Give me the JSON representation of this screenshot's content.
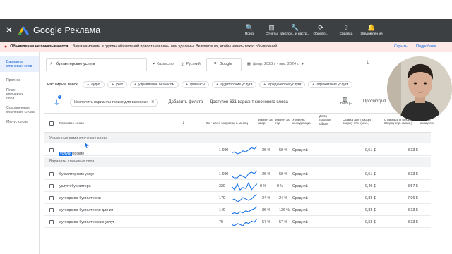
{
  "app": {
    "title": "Google Реклама"
  },
  "toolbar": [
    {
      "label": "Поиск",
      "icon": "search-icon",
      "glyph": "🔍"
    },
    {
      "label": "Отчеты",
      "icon": "reports-icon",
      "glyph": "▥"
    },
    {
      "label": "Инстру... и настр...",
      "icon": "tools-icon",
      "glyph": "🔧"
    },
    {
      "label": "Обновл...",
      "icon": "refresh-icon",
      "glyph": "⟳"
    },
    {
      "label": "Справка",
      "icon": "help-icon",
      "glyph": "?"
    },
    {
      "label": "Уведомлен ия",
      "icon": "bell-icon",
      "glyph": "🔔"
    }
  ],
  "banner": {
    "title": "Объявления не показываются",
    "text": "· Ваши кампании и группы объявлений приостановлены или удалены. Включите их, чтобы начать показ объявлений.",
    "hide": "Скрыть",
    "more": "Подробнее..."
  },
  "sidebar": {
    "items": [
      "Варианты ключевых слов",
      "Прогноз",
      "План ключевых слов",
      "Сохраненные ключевые слова",
      "Минус-слова"
    ]
  },
  "search": {
    "keyword": "бухгалтерские услуги",
    "location": "Казахстан",
    "language": "Русский",
    "network": "Google",
    "date": "февр. 2023 г. - янв. 2024 г."
  },
  "refine": {
    "label": "Расширьте поиск:",
    "chips": [
      "аудит",
      "учет",
      "управление бизнесом",
      "финансы",
      "аудиторские услуги",
      "юридические услуги",
      "адвокатские услуги"
    ]
  },
  "filters": {
    "badge": "1",
    "chip": "Исключить варианты только для взрослых",
    "add": "Добавить фильтр",
    "available": "Доступен 631 вариант ключевого слова",
    "columns": "Столбцы",
    "forecast": "Просмотр п..."
  },
  "table": {
    "headers": {
      "keyword": "Ключевое слово",
      "searches": "Ср. число запросов в месяц",
      "change_q": "Измен за квар",
      "change_y": "Измен за год",
      "competition": "Уровень конкуренции",
      "impr_share": "Доля показов объяв",
      "bid_low": "Ставка для показа вверху стр. (мин.)",
      "bid_high": "Ставка для показа вверху стр. (макс.)",
      "status": "Статус аккаунта"
    },
    "section_provided": "Указанные вами ключевые слова",
    "provided": [
      {
        "kw_pre": "бухгалтерские ",
        "kw_hl": "услуги",
        "searches": "1 600",
        "cq": "+26 %",
        "cy": "+50 %",
        "comp": "Средний",
        "share": "—",
        "low": "0,51 $",
        "high": "3,33 $",
        "trend": [
          4,
          5,
          3,
          4,
          6,
          5,
          7,
          9,
          8,
          10
        ]
      }
    ],
    "section_ideas": "Варианты ключевых слов",
    "ideas": [
      {
        "kw": "бухгалтерских услуг",
        "searches": "1 600",
        "cq": "+26 %",
        "cy": "+50 %",
        "comp": "Средний",
        "share": "—",
        "low": "0,51 $",
        "high": "3,33 $",
        "trend": [
          5,
          4,
          4,
          6,
          5,
          4,
          7,
          8,
          7,
          9
        ]
      },
      {
        "kw": "услуги бухгалтера",
        "searches": "320",
        "cq": "0 %",
        "cy": "0 %",
        "comp": "Средний",
        "share": "—",
        "low": "0,40 $",
        "high": "3,57 $",
        "trend": [
          6,
          3,
          8,
          3,
          5,
          4,
          9,
          3,
          6,
          8
        ]
      },
      {
        "kw": "аутсорсинг бухгалтерии",
        "searches": "170",
        "cq": "+24 %",
        "cy": "+24 %",
        "comp": "Средний",
        "share": "—",
        "low": "0,83 $",
        "high": "7,96 $",
        "trend": [
          5,
          6,
          4,
          5,
          7,
          6,
          5,
          6,
          8,
          9
        ]
      },
      {
        "kw": "аутсорсинг бухгалтерия для ип",
        "searches": "140",
        "cq": "+86 %",
        "cy": "+136 %",
        "comp": "Средний",
        "share": "—",
        "low": "0,83 $",
        "high": "3,33 $",
        "trend": [
          3,
          4,
          3,
          5,
          4,
          6,
          5,
          7,
          8,
          10
        ]
      },
      {
        "kw": "аутсорсинг бухгалтерских услуг",
        "searches": "70",
        "cq": "+57 %",
        "cy": "+57 %",
        "comp": "Средний",
        "share": "—",
        "low": "0,53 $",
        "high": "3,33 $",
        "trend": [
          4,
          3,
          5,
          4,
          3,
          6,
          5,
          7,
          6,
          9
        ]
      }
    ]
  },
  "colors": {
    "topbar": "#3c4043",
    "banner": "#fce8e6",
    "accent": "#1a73e8",
    "warn": "#c5221f"
  }
}
